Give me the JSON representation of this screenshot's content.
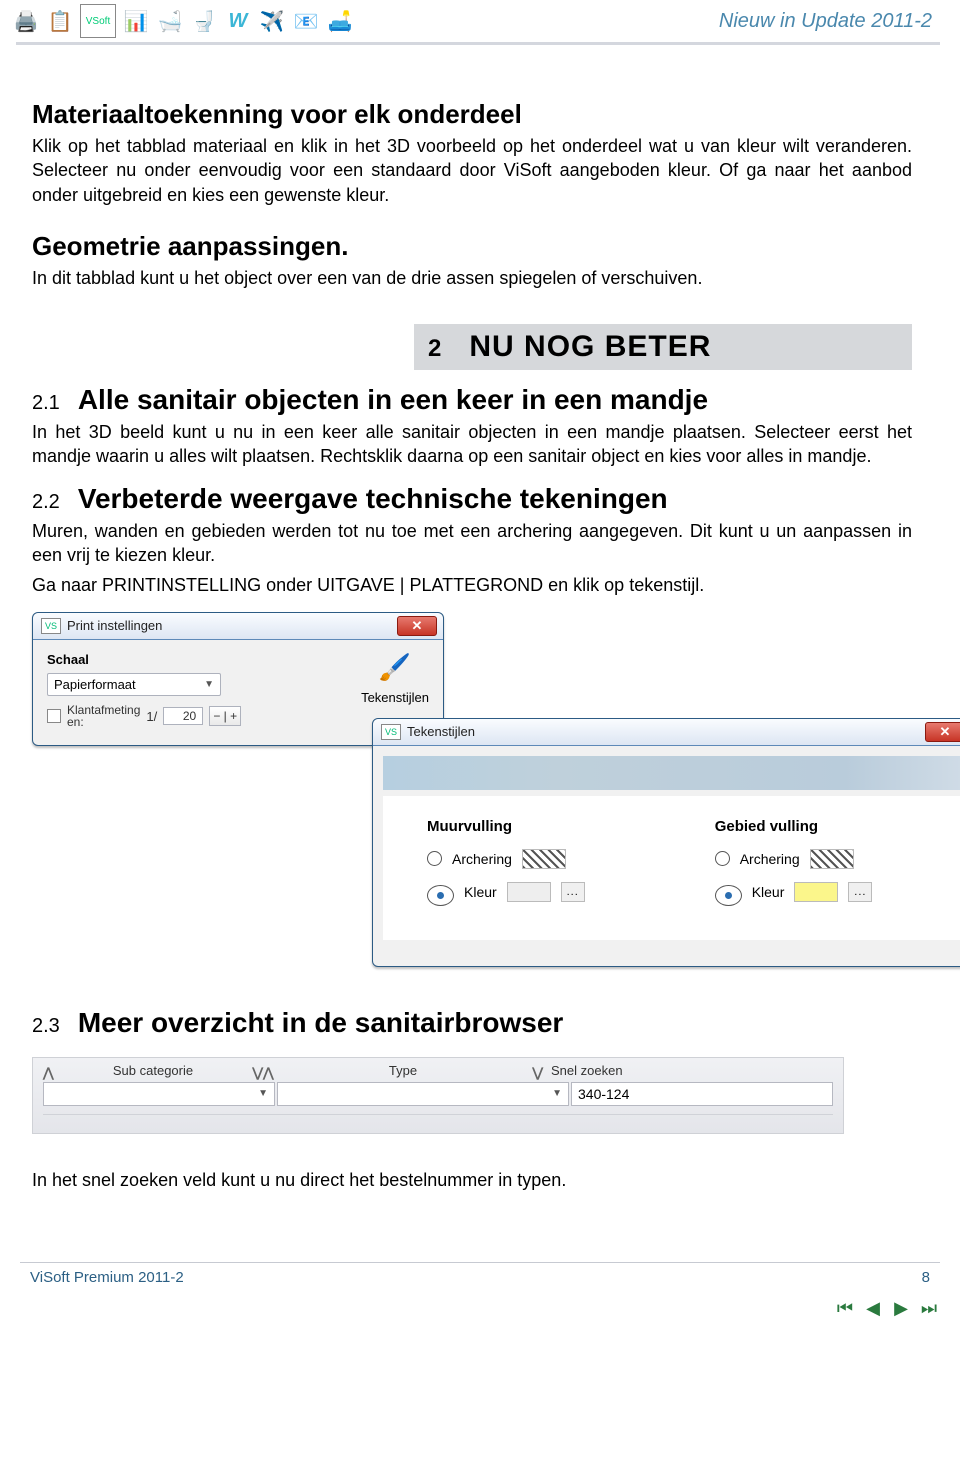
{
  "header": {
    "title": "Nieuw in Update 2011-2"
  },
  "s1": {
    "h": "Materiaaltoekenning voor elk onderdeel",
    "p": "Klik op het tabblad materiaal en klik in het 3D voorbeeld op het onderdeel wat u van kleur wilt veranderen. Selecteer nu onder eenvoudig voor een standaard door ViSoft aangeboden kleur. Of ga naar het aanbod onder uitgebreid en kies een gewenste kleur."
  },
  "s2": {
    "h": "Geometrie aanpassingen.",
    "p": "In dit tabblad kunt u het object over een van de drie assen spiegelen of verschuiven."
  },
  "chapter": {
    "num": "2",
    "txt": "NU NOG BETER"
  },
  "sub21": {
    "n": "2.1",
    "t": "Alle sanitair objecten in een keer in een mandje",
    "p": "In het 3D beeld kunt u nu in een keer alle sanitair objecten in een mandje plaatsen. Selecteer eerst het mandje waarin u alles wilt plaatsen. Rechtsklik daarna op een sanitair object en kies voor alles in mandje."
  },
  "sub22": {
    "n": "2.2",
    "t": "Verbeterde weergave technische tekeningen",
    "p1": "Muren, wanden en gebieden werden tot nu toe met een archering aangegeven. Dit kunt u un aanpassen in een vrij te kiezen kleur.",
    "p2": "Ga naar PRINTINSTELLING onder UITGAVE | PLATTEGROND en klik op tekenstijl."
  },
  "dlg_print": {
    "title": "Print instellingen",
    "schaal": "Schaal",
    "papier": "Papierformaat",
    "klant_l1": "Klantafmeting",
    "klant_l2": "en:",
    "frac_a": "1/",
    "frac_b": "20",
    "spin": "− | +",
    "teken": "Tekenstijlen"
  },
  "dlg_teken": {
    "title": "Tekenstijlen",
    "col1": {
      "title": "Muurvulling",
      "opt1": "Archering",
      "opt2": "Kleur"
    },
    "col2": {
      "title": "Gebied vulling",
      "opt1": "Archering",
      "opt2": "Kleur"
    },
    "dots": "..."
  },
  "sub23": {
    "n": "2.3",
    "t": "Meer overzicht in de sanitairbrowser",
    "p": "In het snel zoeken veld kunt u nu direct het bestelnummer in typen."
  },
  "browser": {
    "subcat": "Sub categorie",
    "type": "Type",
    "snel": "Snel zoeken",
    "value": "340-124"
  },
  "footer": {
    "left": "ViSoft Premium 2011-2",
    "right": "8"
  }
}
